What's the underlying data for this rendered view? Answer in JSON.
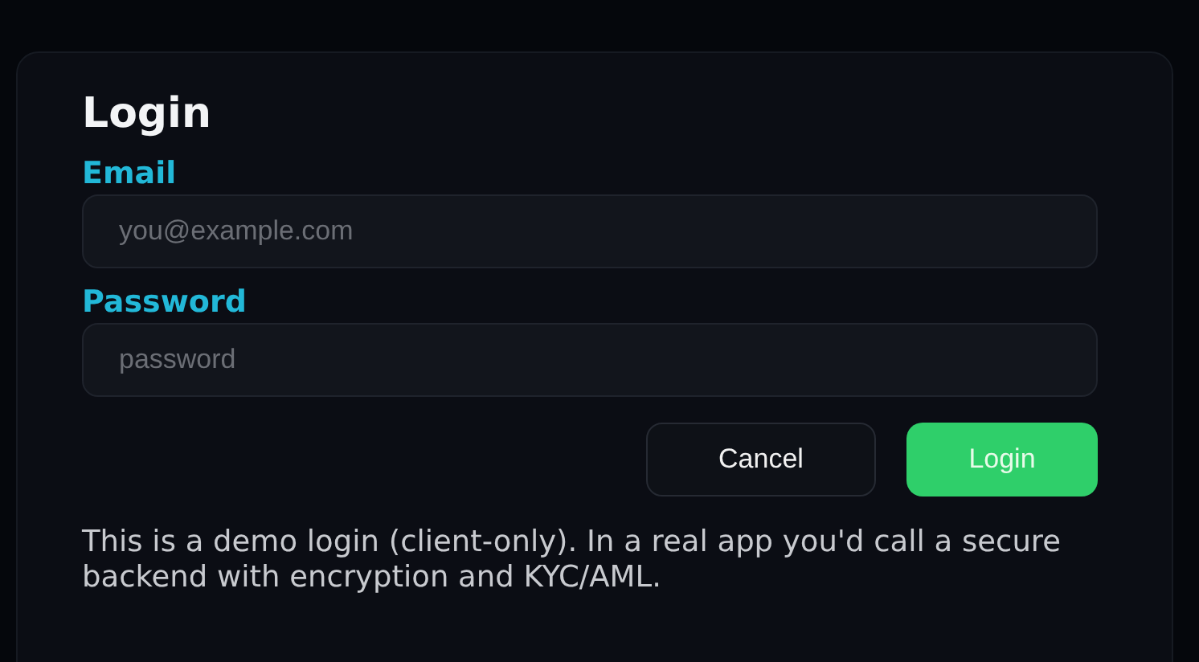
{
  "dialog": {
    "title": "Login",
    "fields": [
      {
        "label": "Email",
        "placeholder": "you@example.com"
      },
      {
        "label": "Password",
        "placeholder": "password"
      }
    ],
    "buttons": [
      {
        "label": "Cancel",
        "kind": "secondary"
      },
      {
        "label": "Login",
        "kind": "primary"
      }
    ],
    "note": "This is a demo login (client-only). In a real app you'd call a secure backend with encryption and KYC/AML."
  }
}
